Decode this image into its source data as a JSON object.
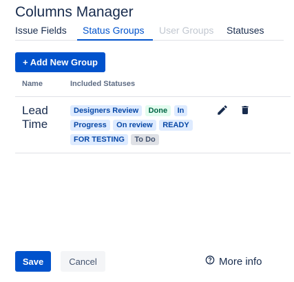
{
  "title": "Columns Manager",
  "tabs": [
    {
      "label": "Issue Fields"
    },
    {
      "label": "Status Groups"
    },
    {
      "label": "User Groups"
    },
    {
      "label": "Statuses"
    }
  ],
  "add_button": "+ Add New Group",
  "table": {
    "headers": {
      "name": "Name",
      "included": "Included Statuses"
    },
    "rows": [
      {
        "name": "Lead Time",
        "statuses": [
          {
            "label": "Designers Review",
            "color": "#deebff"
          },
          {
            "label": "Done",
            "color": "#e3fcef"
          },
          {
            "label": "In Progress",
            "color": "#deebff"
          },
          {
            "label": "On review",
            "color": "#deebff"
          },
          {
            "label": "READY FOR TESTING",
            "color": "#deebff"
          },
          {
            "label": "To Do",
            "color": "#dfe1e6"
          }
        ],
        "actions": [
          "pencil-icon",
          "trash-icon"
        ]
      }
    ]
  },
  "footer": {
    "save": "Save",
    "cancel": "Cancel",
    "more_info": "More info"
  },
  "colors": {
    "accent": "#0052cc",
    "text": "#172b4d"
  }
}
